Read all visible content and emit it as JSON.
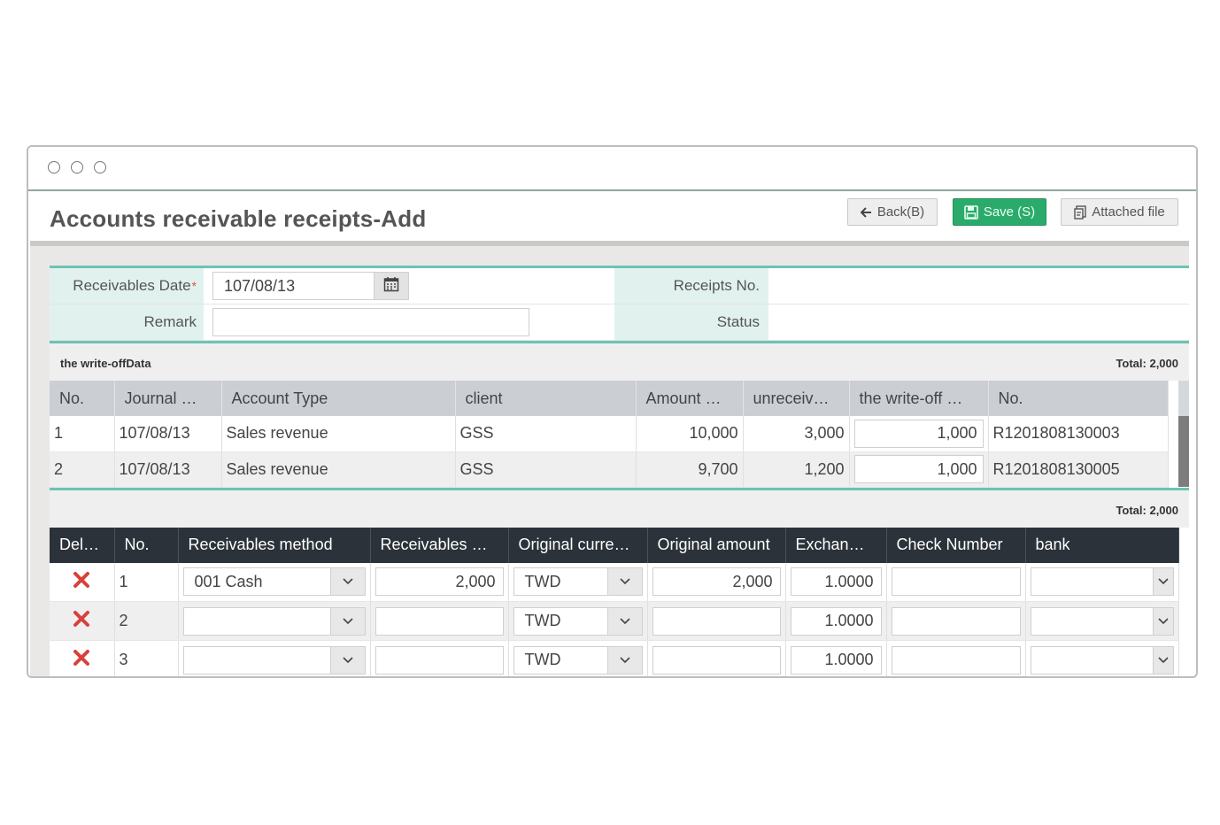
{
  "header": {
    "title": "Accounts receivable receipts-Add",
    "back_label": "Back(B)",
    "save_label": "Save (S)",
    "attach_label": "Attached file"
  },
  "form": {
    "receivables_date_label": "Receivables Date",
    "required_mark": "*",
    "receivables_date_value": "107/08/13",
    "remark_label": "Remark",
    "remark_value": "",
    "receipts_no_label": "Receipts No.",
    "receipts_no_value": "",
    "status_label": "Status",
    "status_value": ""
  },
  "writeoff": {
    "section_title": "the write-offData",
    "total": "Total: 2,000",
    "columns": [
      "No.",
      "Journal …",
      "Account Type",
      "client",
      "Amount …",
      "unreceiv…",
      "the write-off …",
      "No."
    ],
    "rows": [
      {
        "no": "1",
        "journal": "107/08/13",
        "account_type": "Sales revenue",
        "client": "GSS",
        "amount": "10,000",
        "unreceived": "3,000",
        "writeoff": "1,000",
        "ref": "R1201808130003"
      },
      {
        "no": "2",
        "journal": "107/08/13",
        "account_type": "Sales revenue",
        "client": "GSS",
        "amount": "9,700",
        "unreceived": "1,200",
        "writeoff": "1,000",
        "ref": "R1201808130005"
      }
    ]
  },
  "receivables": {
    "total": "Total: 2,000",
    "columns": [
      "Del…",
      "No.",
      "Receivables method",
      "Receivables …",
      "Original curre…",
      "Original amount",
      "Exchan…",
      "Check Number",
      "bank"
    ],
    "rows": [
      {
        "no": "1",
        "method": "001 Cash",
        "receivables": "2,000",
        "currency": "TWD",
        "original_amount": "2,000",
        "exchange": "1.0000",
        "check_number": "",
        "bank": ""
      },
      {
        "no": "2",
        "method": "",
        "receivables": "",
        "currency": "TWD",
        "original_amount": "",
        "exchange": "1.0000",
        "check_number": "",
        "bank": ""
      },
      {
        "no": "3",
        "method": "",
        "receivables": "",
        "currency": "TWD",
        "original_amount": "",
        "exchange": "1.0000",
        "check_number": "",
        "bank": ""
      }
    ]
  },
  "colors": {
    "accent_teal": "#6cc3b5",
    "save_green": "#2bab6b",
    "dark_header": "#2b323a",
    "delete_red": "#d9403a"
  }
}
